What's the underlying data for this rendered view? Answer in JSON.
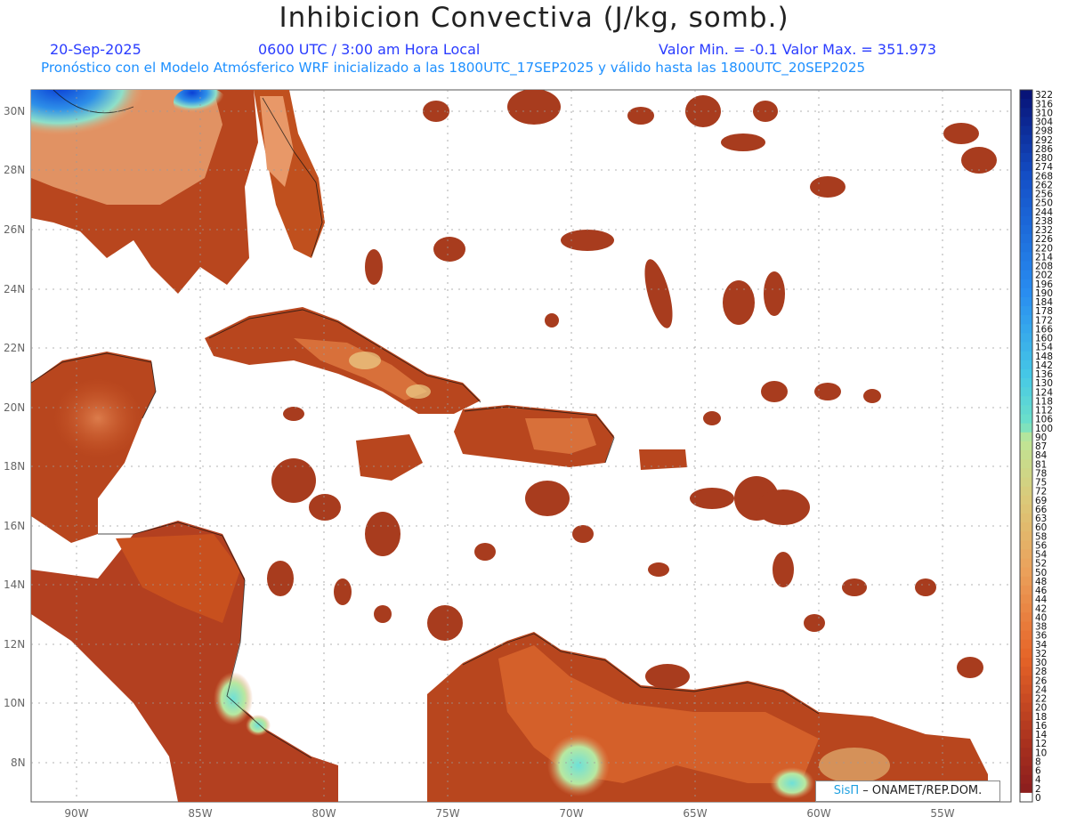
{
  "header": {
    "title": "Inhibicion Convectiva (J/kg, somb.)",
    "date": "20-Sep-2025",
    "time": "0600 UTC / 3:00 am Hora Local",
    "range": "Valor Min. = -0.1  Valor Max. = 351.973",
    "model": "Pronóstico con el Modelo Atmósferico WRF inicializado a las 1800UTC_17SEP2025 y válido hasta las  1800UTC_20SEP2025"
  },
  "axes": {
    "lat_labels": [
      "30N",
      "28N",
      "26N",
      "24N",
      "22N",
      "20N",
      "18N",
      "16N",
      "14N",
      "12N",
      "10N",
      "8N"
    ],
    "lon_labels": [
      "90W",
      "85W",
      "80W",
      "75W",
      "70W",
      "65W",
      "60W",
      "55W"
    ]
  },
  "colorbar": {
    "labels": [
      "322",
      "316",
      "310",
      "304",
      "298",
      "292",
      "286",
      "280",
      "274",
      "268",
      "262",
      "256",
      "250",
      "244",
      "238",
      "232",
      "226",
      "220",
      "214",
      "208",
      "202",
      "196",
      "190",
      "184",
      "178",
      "172",
      "166",
      "160",
      "154",
      "148",
      "142",
      "136",
      "130",
      "124",
      "118",
      "112",
      "106",
      "100",
      "90",
      "87",
      "84",
      "81",
      "78",
      "75",
      "72",
      "69",
      "66",
      "63",
      "60",
      "58",
      "56",
      "54",
      "52",
      "50",
      "48",
      "46",
      "44",
      "42",
      "40",
      "38",
      "36",
      "34",
      "32",
      "30",
      "28",
      "26",
      "24",
      "22",
      "20",
      "18",
      "16",
      "14",
      "12",
      "10",
      "8",
      "6",
      "4",
      "2",
      "0"
    ]
  },
  "credit": {
    "sis": "SisΠ",
    "rest": "– ONAMET/REP.DOM."
  }
}
